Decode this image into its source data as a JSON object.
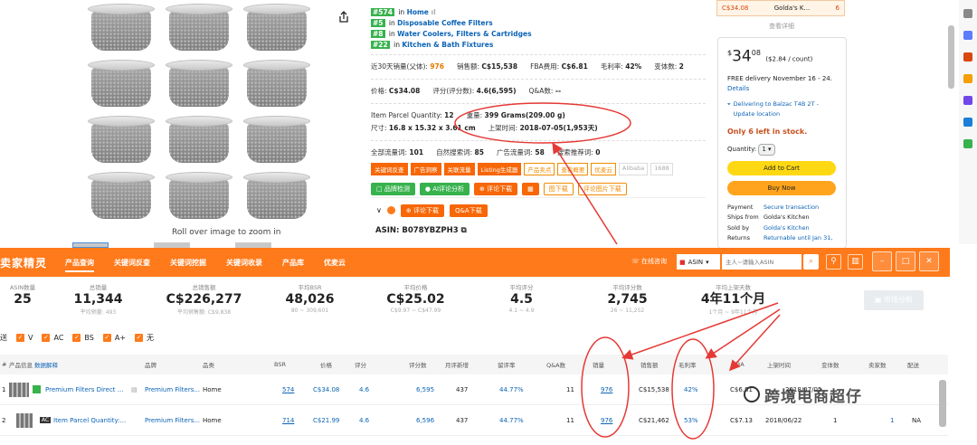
{
  "gallery": {
    "zoom_hint": "Roll over image to zoom in"
  },
  "ranks": [
    {
      "num": "#574",
      "in": " in ",
      "cat": "Home"
    },
    {
      "num": "#5",
      "in": " in ",
      "cat": "Disposable Coffee Filters"
    },
    {
      "num": "#8",
      "in": " in ",
      "cat": "Water Coolers, Filters & Cartridges"
    },
    {
      "num": "#22",
      "in": " in ",
      "cat": "Kitchen & Bath Fixtures"
    }
  ],
  "stats": {
    "row1": [
      {
        "label": "近30天销量(父体):",
        "value": "976"
      },
      {
        "label": "销售额:",
        "value": "C$15,538"
      },
      {
        "label": "FBA费用:",
        "value": "C$6.81"
      },
      {
        "label": "毛利率:",
        "value": "42%"
      },
      {
        "label": "变体数:",
        "value": "2"
      }
    ],
    "row2": [
      {
        "label": "价格:",
        "value": "C$34.08"
      },
      {
        "label": "评分(评分数):",
        "value": "4.6(6,595)"
      },
      {
        "label": "Q&A数:",
        "value": "--"
      }
    ],
    "row3": [
      {
        "label": "Item Parcel Quantity:",
        "value": "12"
      },
      {
        "label": "重量:",
        "value": "399 Grams(209.00 g)"
      }
    ],
    "row4": [
      {
        "label": "尺寸:",
        "value": "16.8 x 15.32 x 3.61 cm"
      },
      {
        "label": "上架时间:",
        "value": "2018-07-05(1,953天)"
      }
    ],
    "row5": [
      {
        "label": "全部流量词:",
        "value": "101"
      },
      {
        "label": "自然搜索词:",
        "value": "85"
      },
      {
        "label": "广告流量词:",
        "value": "58"
      },
      {
        "label": "搜索推荐词:",
        "value": "0"
      }
    ]
  },
  "tags": [
    "关键词反查",
    "广告洞察",
    "关联流量",
    "Listing生成器",
    "产品卖点",
    "查看概要",
    "优麦云",
    "Alibaba",
    "1688"
  ],
  "action_buttons": [
    "品牌检测",
    "AI评论分析",
    "评论下载",
    "",
    "图下载",
    "评论图片下载"
  ],
  "review_bar": [
    "评论下载",
    "Q&A下载"
  ],
  "asin_line": "ASIN: B078YBZPH3",
  "seller_top": {
    "price": "C$34.08",
    "name": "Golda's K...",
    "count": "6"
  },
  "view_more": "查看详细",
  "buybox": {
    "price_sym": "$",
    "price_int": "34",
    "price_dec": "08",
    "unit": "($2.84 / count)",
    "delivery": "FREE delivery November 16 - 24.",
    "details": "Details",
    "deliver_to": "Delivering to Balzac T4B 2T - Update location",
    "stock": "Only 6 left in stock.",
    "qty_label": "Quantity:",
    "qty_value": "1",
    "add_cart": "Add to Cart",
    "buy_now": "Buy Now",
    "info": [
      {
        "k": "Payment",
        "v": "Secure transaction",
        "link": true
      },
      {
        "k": "Ships from",
        "v": "Golda's Kitchen",
        "link": false
      },
      {
        "k": "Sold by",
        "v": "Golda's Kitchen",
        "link": true
      },
      {
        "k": "Returns",
        "v": "Returnable until Jan 31,",
        "link": true
      }
    ]
  },
  "plugin": {
    "logo": "卖家精灵",
    "nav": [
      "产品查询",
      "关键词反查",
      "关键词挖掘",
      "关键词收录",
      "产品库",
      "优麦云"
    ],
    "online_help": "在线咨询",
    "market": "ASIN",
    "search_placeholder": "主人~请输入ASIN"
  },
  "metrics": [
    {
      "label": "ASIN数量",
      "value": "25",
      "sub": ""
    },
    {
      "label": "总销量",
      "value": "11,344",
      "sub": "平均销量: 493"
    },
    {
      "label": "总销售额",
      "value": "C$226,277",
      "sub": "平均销售额: C$9,838"
    },
    {
      "label": "平均BSR",
      "value": "48,026",
      "sub": "80 ~ 309,601"
    },
    {
      "label": "平均价格",
      "value": "C$25.02",
      "sub": "C$9.97 ~ C$47.99"
    },
    {
      "label": "平均评分",
      "value": "4.5",
      "sub": "4.1 ~ 4.9"
    },
    {
      "label": "平均评分数",
      "value": "2,745",
      "sub": "26 ~ 11,252"
    },
    {
      "label": "平均上架天数",
      "value": "4年11个月",
      "sub": "1个月 ~ 9年11个月"
    }
  ],
  "market_btn": "市场分析",
  "filters": {
    "label": "配送",
    "options": [
      "V",
      "AC",
      "BS",
      "A+",
      "无"
    ]
  },
  "table": {
    "headers": [
      "#",
      "产品信息",
      "数据解释",
      "品牌",
      "品类",
      "BSR",
      "价格",
      "评分",
      "评分数",
      "月评新增",
      "留评率",
      "Q&A数",
      "销量",
      "销售额",
      "毛利率",
      "FBA",
      "上架时间",
      "变体数",
      "卖家数",
      "配送"
    ],
    "rows": [
      {
        "n": "1",
        "title": "Premium Filters Direct ...",
        "badge": "",
        "brand": "Premium Filters...",
        "cat": "Home",
        "bsr": "574",
        "price": "C$34.08",
        "rating": "4.6",
        "ratings": "6,595",
        "monthly": "437",
        "rate": "44.77%",
        "qa": "11",
        "sales": "976",
        "revenue": "C$15,538",
        "margin": "42%",
        "fba": "C$6.81",
        "date": "2018/07/05",
        "variants": "2",
        "sellers": "13",
        "ship": "FBA"
      },
      {
        "n": "2",
        "title": "Item Parcel Quantity:...",
        "badge": "AC",
        "brand": "Premium Filters...",
        "cat": "Home",
        "bsr": "714",
        "price": "C$21.99",
        "rating": "4.6",
        "ratings": "6,596",
        "monthly": "437",
        "rate": "44.77%",
        "qa": "11",
        "sales": "976",
        "revenue": "C$21,462",
        "margin": "53%",
        "fba": "C$7.13",
        "date": "2018/06/22",
        "variants": "1",
        "sellers": "1",
        "ship": "NA"
      }
    ]
  },
  "watermark": "跨境电商超仔",
  "colors": {
    "brand": "#ff7a1a",
    "annotation": "#e53935",
    "link": "#0b63b5",
    "rank_badge": "#37b24d"
  }
}
